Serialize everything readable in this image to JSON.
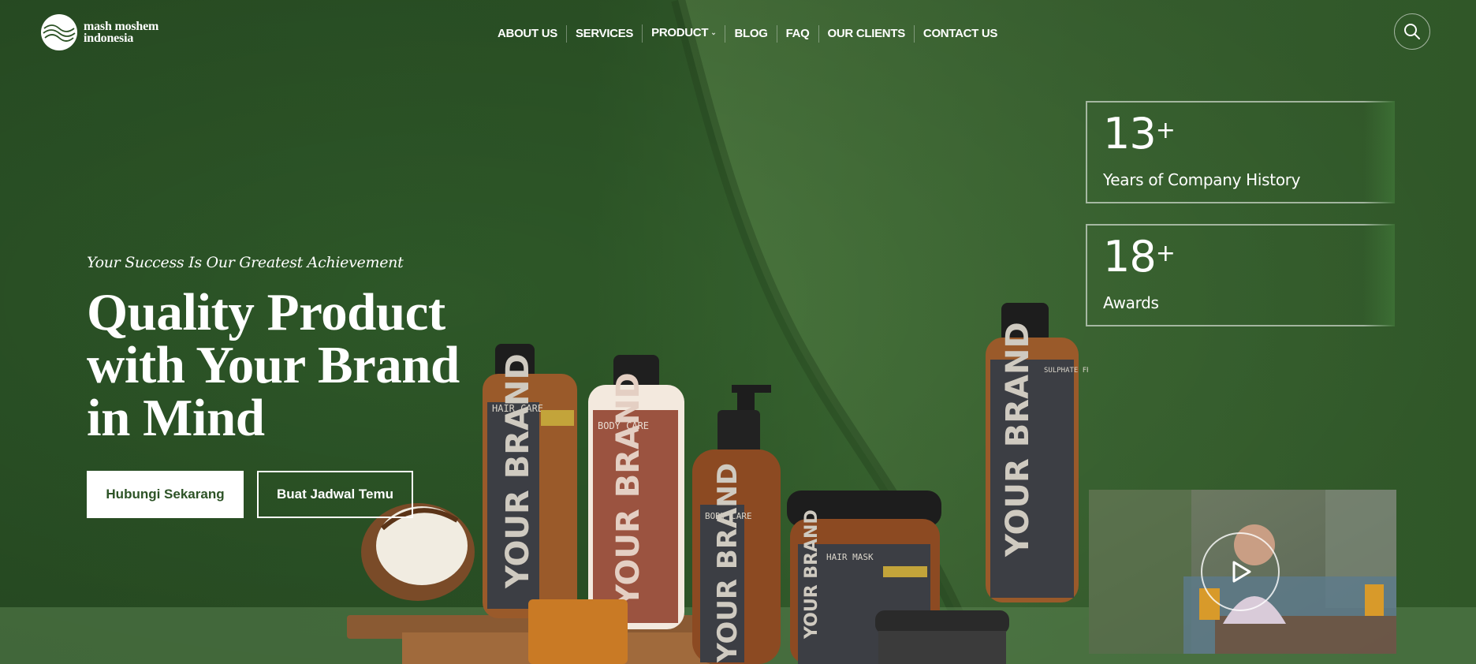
{
  "brand": {
    "name_line1": "mash moshem",
    "name_line2": "indonesia"
  },
  "nav": {
    "items": [
      "ABOUT US",
      "SERVICES",
      "PRODUCT",
      "BLOG",
      "FAQ",
      "OUR CLIENTS",
      "CONTACT US"
    ],
    "product_has_dropdown": true
  },
  "icons": {
    "search": "search-icon",
    "play": "play-icon",
    "chevron": "chevron-down-icon"
  },
  "hero": {
    "tagline": "Your Success Is Our Greatest Achievement",
    "headline_line1": "Quality Product",
    "headline_line2": "with Your Brand",
    "headline_line3": "in Mind",
    "primary_button": "Hubungi Sekarang",
    "secondary_button": "Buat Jadwal Temu"
  },
  "stats": [
    {
      "number": "13",
      "suffix": "+",
      "label": "Years of Company History"
    },
    {
      "number": "18",
      "suffix": "+",
      "label": "Awards"
    }
  ],
  "product_labels": {
    "brand": "YOUR BRAND",
    "hair_care": "HAIR CARE",
    "body_care": "BODY CARE",
    "hair_mask": "HAIR MASK",
    "shampoo": "SULPHATE FREE SHAMPOO"
  },
  "colors": {
    "primary_green": "#2d5326",
    "accent_mustard": "#c3a43a",
    "white": "#ffffff"
  }
}
